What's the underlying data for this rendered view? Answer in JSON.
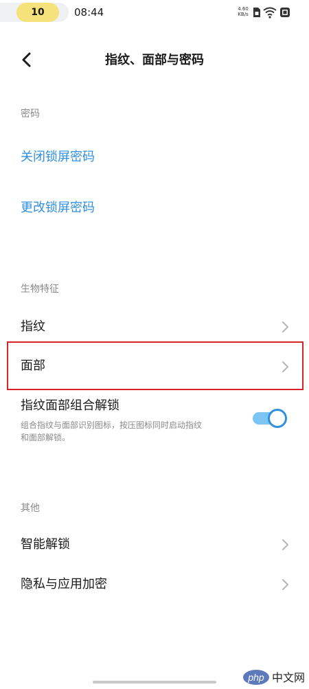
{
  "status_bar": {
    "pill_number": "10",
    "time": "08:44",
    "net_speed_value": "4.60",
    "net_speed_unit": "KB/s"
  },
  "header": {
    "title": "指纹、面部与密码"
  },
  "sections": {
    "password": {
      "header": "密码",
      "items": [
        {
          "label": "关闭锁屏密码"
        },
        {
          "label": "更改锁屏密码"
        }
      ]
    },
    "biometrics": {
      "header": "生物特征",
      "items": [
        {
          "label": "指纹"
        },
        {
          "label": "面部"
        }
      ],
      "combo_unlock": {
        "label": "指纹面部组合解锁",
        "description": "组合指纹与面部识别图标，按压图标同时启动指纹和面部解锁。",
        "enabled": true
      }
    },
    "other": {
      "header": "其他",
      "items": [
        {
          "label": "智能解锁"
        },
        {
          "label": "隐私与应用加密"
        }
      ]
    }
  },
  "colors": {
    "accent": "#2f8fe0",
    "highlight": "#d8232a"
  },
  "watermark": {
    "text_php": "php",
    "text_site": "中文网"
  }
}
